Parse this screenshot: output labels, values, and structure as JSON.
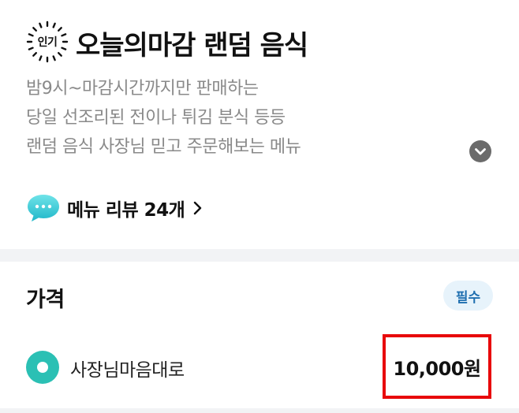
{
  "menu": {
    "badge": "인기",
    "title": "오늘의마감 랜덤 음식",
    "description": [
      "밤9시~마감시간까지만 판매하는",
      "당일 선조리된 전이나 튀김 분식 등등",
      "랜덤 음식  사장님 믿고 주문해보는 메뉴"
    ],
    "expand_icon": "chevron-down-icon",
    "review": {
      "icon": "speech-bubble-icon",
      "label": "메뉴 리뷰 24개",
      "chevron": ">"
    }
  },
  "price_section": {
    "title": "가격",
    "required_badge": "필수",
    "options": [
      {
        "label": "사장님마음대로",
        "price": "10,000원",
        "selected": true
      }
    ]
  },
  "colors": {
    "accent_teal": "#2bc0b4",
    "required_bg": "#e7f3fb",
    "required_text": "#1f6fb0",
    "highlight_red": "#e8090b",
    "description_gray": "#8a8a8a"
  }
}
